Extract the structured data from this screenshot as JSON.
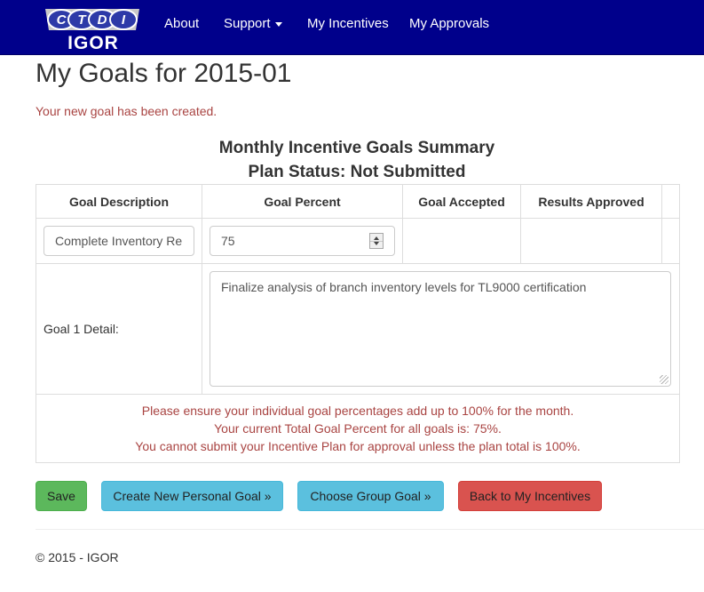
{
  "nav": {
    "brand_letters": [
      "C",
      "T",
      "D",
      "I"
    ],
    "brand_text": "IGOR",
    "links": [
      "About",
      "Support",
      "My Incentives",
      "My Approvals"
    ]
  },
  "page": {
    "title": "My Goals for 2015-01",
    "flash": "Your new goal has been created.",
    "summary_title": "Monthly Incentive Goals Summary",
    "plan_status": "Plan Status: Not Submitted"
  },
  "table": {
    "headers": [
      "Goal Description",
      "Goal Percent",
      "Goal Accepted",
      "Results Approved"
    ],
    "goal_description_value": "Complete Inventory Re",
    "goal_percent_value": "75",
    "detail_label": "Goal 1 Detail:",
    "detail_value": "Finalize analysis of branch inventory levels for TL9000 certification",
    "notes": [
      "Please ensure your individual goal percentages add up to 100% for the month.",
      "Your current Total Goal Percent for all goals is: 75%.",
      "You cannot submit your Incentive Plan for approval unless the plan total is 100%."
    ]
  },
  "buttons": {
    "save": "Save",
    "new_personal_goal": "Create New Personal Goal »",
    "choose_group_goal": "Choose Group Goal »",
    "back": "Back to My Incentives"
  },
  "footer": "© 2015 - IGOR",
  "colors": {
    "navbar": "#00008b",
    "error_text": "#a94442",
    "success": "#5cb85c",
    "info": "#5bc0de",
    "danger": "#d9534f"
  }
}
